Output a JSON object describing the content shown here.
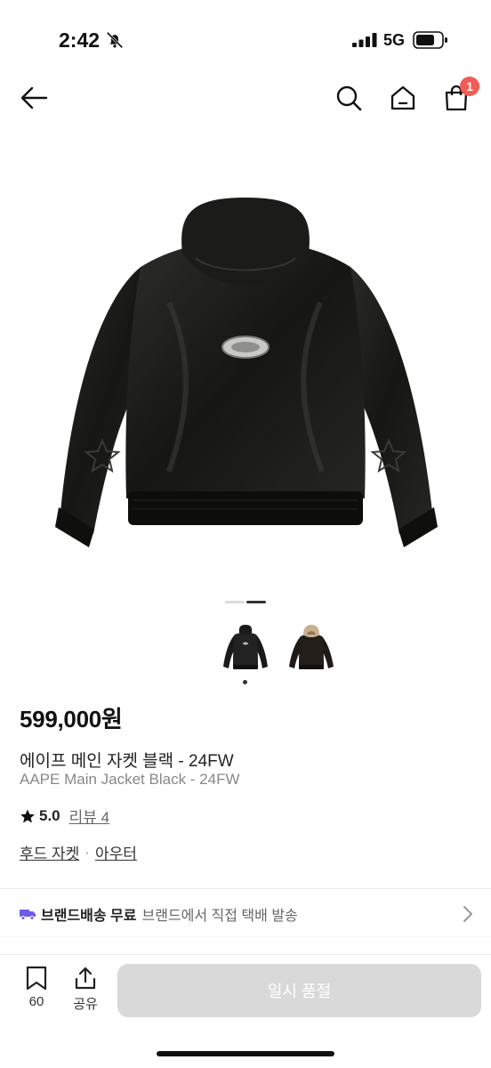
{
  "status": {
    "time": "2:42",
    "network": "5G"
  },
  "nav": {
    "cart_count": "1"
  },
  "product": {
    "price": "599,000원",
    "name_ko": "에이프 메인 자켓 블랙 - 24FW",
    "name_en": "AAPE Main Jacket Black - 24FW",
    "rating": "5.0",
    "review_label": "리뷰 4",
    "categories": [
      "후드 자켓",
      "아우터"
    ],
    "category_separator": "·"
  },
  "gallery": {
    "total": 2,
    "current": 2
  },
  "shipping": {
    "badge": "브랜드배송 무료",
    "description": "브랜드에서 직접 택배 발송"
  },
  "bottom": {
    "bookmark_count": "60",
    "share_label": "공유",
    "cta_label": "일시 품절"
  },
  "colors": {
    "badge": "#f25c54",
    "cta_disabled": "#d9d9d9",
    "truck": "#6b5de8"
  }
}
